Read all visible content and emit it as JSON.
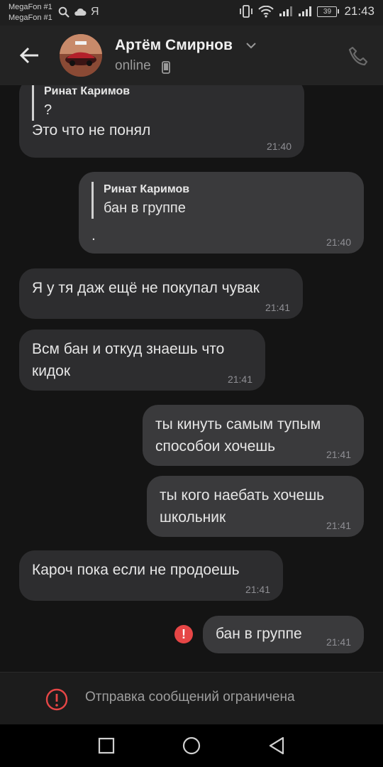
{
  "status_bar": {
    "carrier1": "MegaFon #1",
    "carrier2": "MegaFon #1",
    "yandex_glyph": "Я",
    "battery": "39",
    "time": "21:43"
  },
  "header": {
    "name": "Артём Смирнов",
    "status": "online"
  },
  "messages": [
    {
      "reply_author": "Ринат Каримов",
      "reply_text": "?",
      "text": "Это что не понял",
      "time": "21:40"
    },
    {
      "reply_author": "Ринат Каримов",
      "reply_text": "бан в группе",
      "text": ".",
      "time": "21:40"
    },
    {
      "text": "Я у тя даж ещё не покупал чувак",
      "time": "21:41"
    },
    {
      "line1": "Всм бан и откуд знаешь что",
      "line2": "кидок",
      "time": "21:41"
    },
    {
      "line1": "ты кинуть самым тупым",
      "line2": "способои хочешь",
      "time": "21:41"
    },
    {
      "line1": "ты кого наебать хочешь",
      "line2": "школьник",
      "time": "21:41"
    },
    {
      "text": "Кароч пока если не продоешь",
      "time": "21:41"
    },
    {
      "text": "бан в группе",
      "time": "21:41"
    }
  ],
  "error_badge": "!",
  "restriction": {
    "text": "Отправка сообщений ограничена"
  },
  "colors": {
    "error": "#e64646",
    "bubble_in": "#2d2d2f",
    "bubble_out": "#3a3a3c",
    "background": "#141414"
  },
  "icons": [
    "back-arrow-icon",
    "chevron-down-icon",
    "mobile-phone-icon",
    "phone-call-icon",
    "search-icon",
    "cloud-icon",
    "vibrate-icon",
    "wifi-icon",
    "signal-icon",
    "battery-icon",
    "error-icon",
    "square-icon",
    "circle-icon",
    "triangle-back-icon"
  ]
}
